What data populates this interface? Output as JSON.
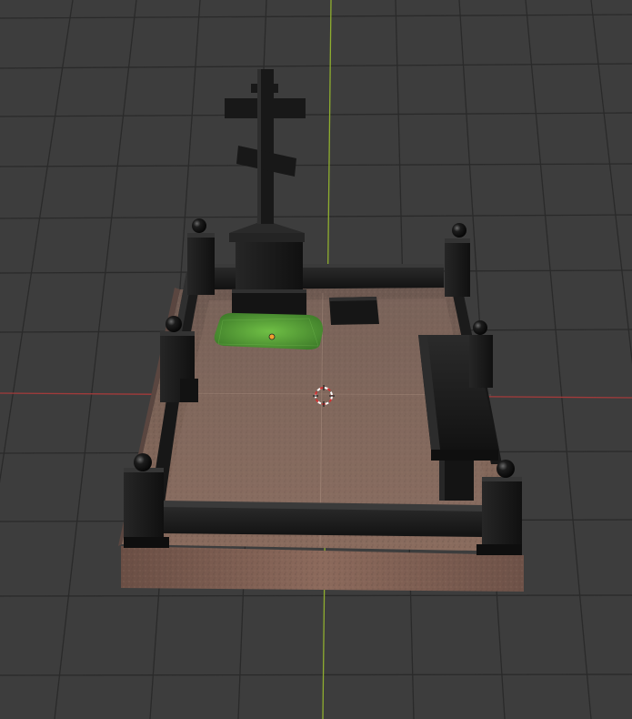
{
  "viewport": {
    "background": "#3d3d3d",
    "grid_color": "#2a2a2a",
    "x_axis_color": "#a23b3b",
    "y_axis_color": "#8fae2f"
  },
  "scene": {
    "object": "grave-monument-model",
    "granite_color": "#7a5e52",
    "black_granite_color": "#1a1a1a",
    "grass_color": "#5aa83a"
  },
  "overlay": {
    "cursor_3d": "3d-cursor-icon",
    "origin_marker": "object-origin-dot",
    "origin_color": "#f0a030"
  }
}
